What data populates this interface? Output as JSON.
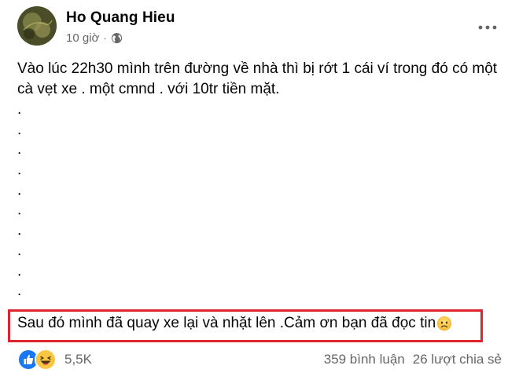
{
  "post": {
    "author": "Ho Quang Hieu",
    "time": "10 giờ",
    "privacy_icon": "globe-icon",
    "menu_icon": "more-horizontal-icon",
    "paragraph": "Vào lúc 22h30 mình trên đường về nhà thì bị rớt 1 cái ví trong đó có một cà vẹt xe . một cmnd . với 10tr tiền mặt.",
    "dots": [
      ".",
      ".",
      ".",
      ".",
      ".",
      ".",
      ".",
      ".",
      ".",
      "."
    ],
    "highlighted_text": "Sau đó mình đã quay xe lại và nhặt lên .Cảm ơn bạn đã đọc tin",
    "highlight_color": "#e0242f",
    "trailing_emoji": "sad-face-emoji"
  },
  "footer": {
    "reaction_icons": [
      "like-icon",
      "haha-icon"
    ],
    "reaction_count": "5,5K",
    "comments": "359 bình luận",
    "shares": "26 lượt chia sẻ"
  }
}
